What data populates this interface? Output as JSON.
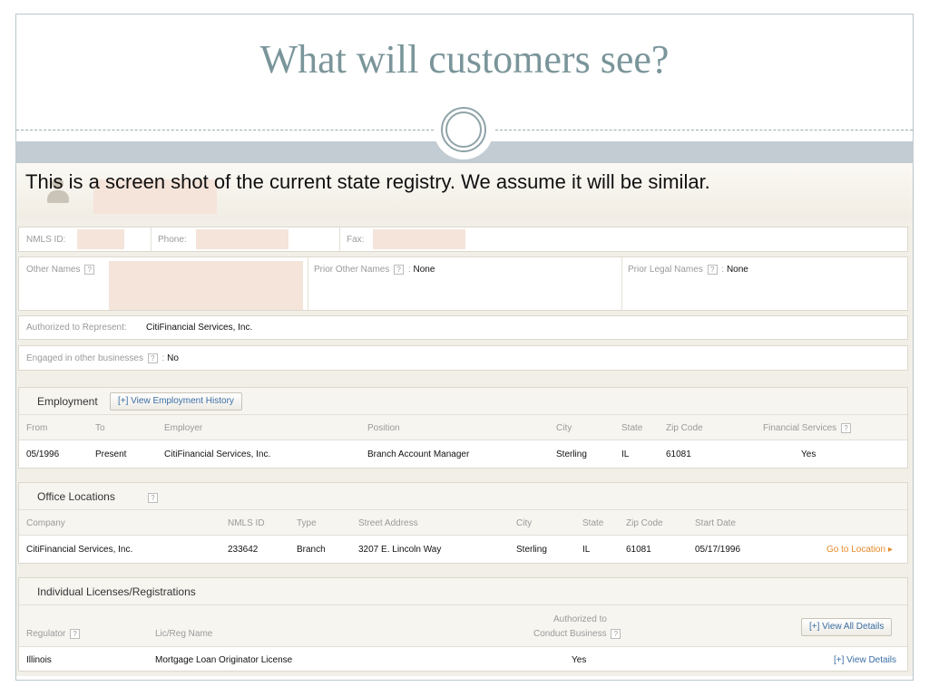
{
  "slide": {
    "title": "What will customers see?",
    "caption": "This is a screen shot of the current state registry.  We assume it will be similar."
  },
  "profile": {
    "nmls_label": "NMLS ID: ",
    "phone_label": "Phone:",
    "fax_label": "Fax:",
    "other_names_label": "Other Names",
    "prior_other_names_label": "Prior Other Names",
    "prior_other_names_value": "None",
    "prior_legal_names_label": "Prior Legal Names",
    "prior_legal_names_value": "None",
    "authorized_label": "Authorized to Represent:",
    "authorized_value": "CitiFinancial Services, Inc.",
    "engaged_label": "Engaged in other businesses",
    "engaged_value": "No",
    "help_glyph": "?",
    "colon": ":"
  },
  "employment": {
    "title": "Employment",
    "history_button": "[+] View Employment History",
    "columns": [
      "From",
      "To",
      "Employer",
      "Position",
      "City",
      "State",
      "Zip Code",
      "Financial Services"
    ],
    "rows": [
      [
        "05/1996",
        "Present",
        "CitiFinancial Services, Inc.",
        "Branch Account Manager",
        "Sterling",
        "IL",
        "61081",
        "Yes"
      ]
    ]
  },
  "offices": {
    "title": "Office Locations",
    "columns": [
      "Company",
      "NMLS ID",
      "Type",
      "Street Address",
      "City",
      "State",
      "Zip Code",
      "Start Date"
    ],
    "rows": [
      [
        "CitiFinancial Services, Inc.",
        "233642",
        "Branch",
        "3207 E. Lincoln Way",
        "Sterling",
        "IL",
        "61081",
        "05/17/1996"
      ]
    ],
    "go_link": "Go to Location ▸"
  },
  "licenses": {
    "title": "Individual Licenses/Registrations",
    "col_regulator": "Regulator",
    "col_name": "Lic/Reg Name",
    "col_auth_line1": "Authorized to",
    "col_auth_line2": "Conduct Business",
    "view_all_button": "[+] View All Details",
    "rows": [
      {
        "regulator": "Illinois",
        "name": "Mortgage Loan Originator License",
        "authorized": "Yes",
        "link": "[+] View Details"
      }
    ]
  },
  "icons": [
    "user-silhouette-icon",
    "help-icon",
    "circle-ornament-icon"
  ]
}
